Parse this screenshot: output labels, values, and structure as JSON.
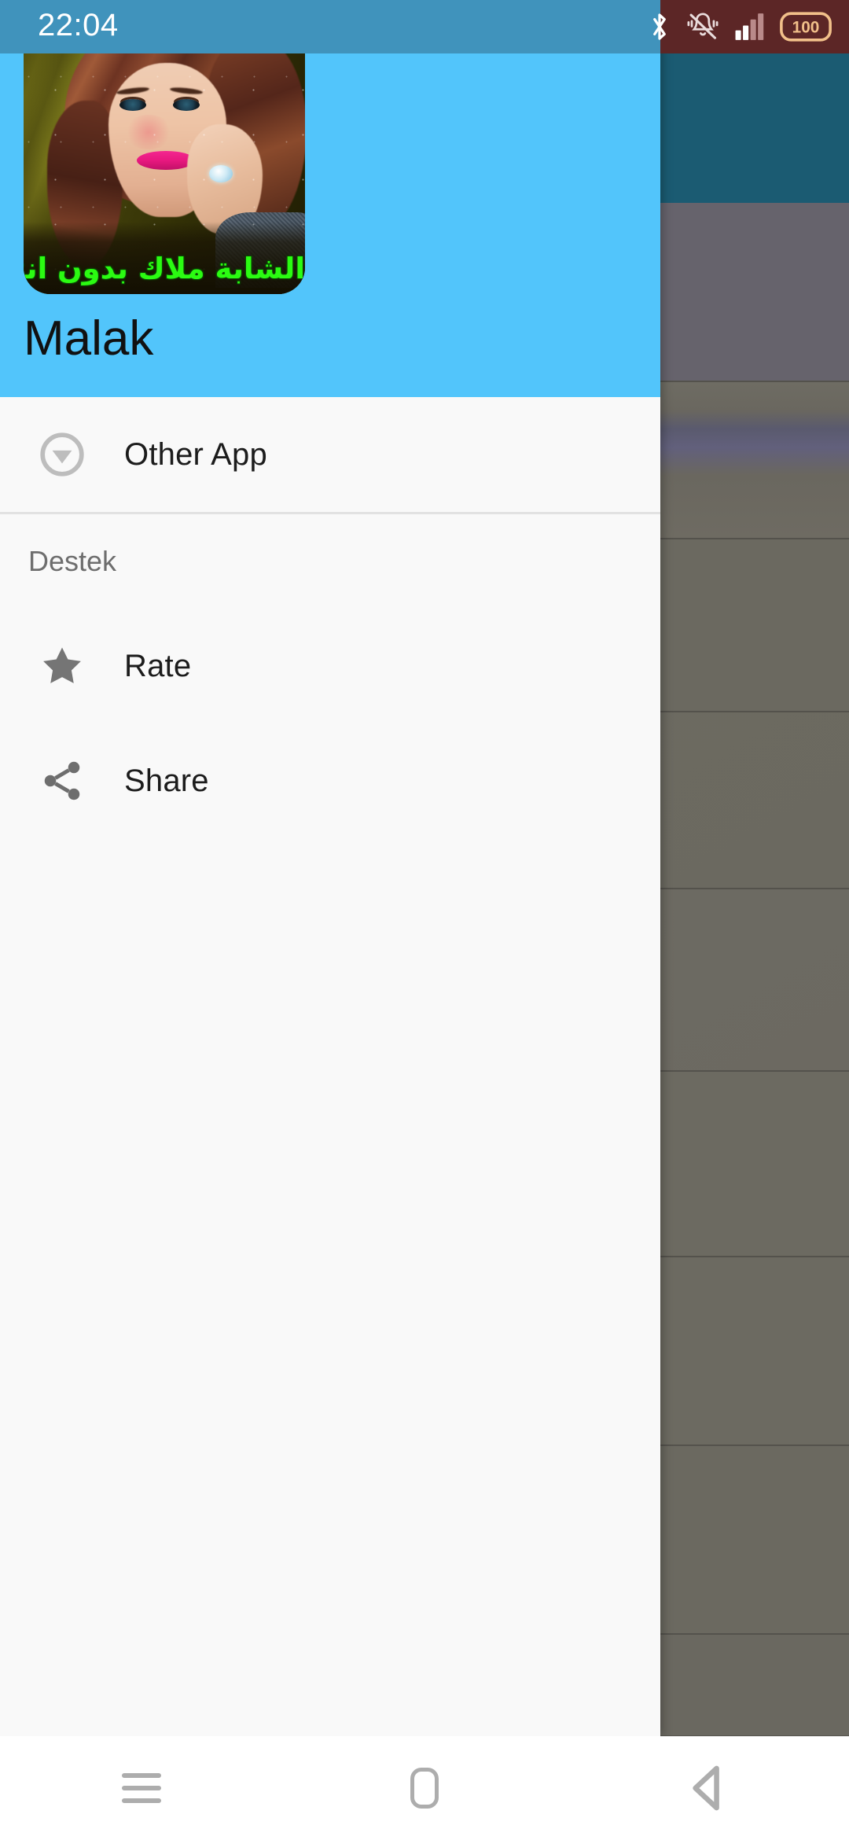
{
  "status_bar": {
    "time": "22:04",
    "battery_level": "100",
    "icons": [
      "bluetooth-icon",
      "silent-vibrate-icon",
      "signal-bars-icon",
      "battery-icon"
    ],
    "left_bg_color": "#4093BC",
    "right_bg_color": "#5C2626"
  },
  "drawer": {
    "app_name": "Malak",
    "header_color": "#52C5FB",
    "background_color": "#F9F9F9",
    "app_icon": {
      "name": "app-launcher-icon",
      "caption_arabic": "الشابة ملاك بدون انترنت",
      "caption_color": "#2BFB12"
    },
    "menu_items": [
      {
        "label": "Other App",
        "icon": "circle-down-arrow-icon"
      }
    ],
    "sections": [
      {
        "title": "Destek",
        "items": [
          {
            "label": "Rate",
            "icon": "star-icon"
          },
          {
            "label": "Share",
            "icon": "share-icon"
          }
        ]
      }
    ]
  },
  "background_app": {
    "toolbar_color": "#1B5B72",
    "scrim_color": "#6C6A61"
  },
  "nav_bar": {
    "buttons": [
      {
        "label": "Recents",
        "icon": "recents-icon"
      },
      {
        "label": "Home",
        "icon": "home-icon"
      },
      {
        "label": "Back",
        "icon": "back-icon"
      }
    ]
  }
}
